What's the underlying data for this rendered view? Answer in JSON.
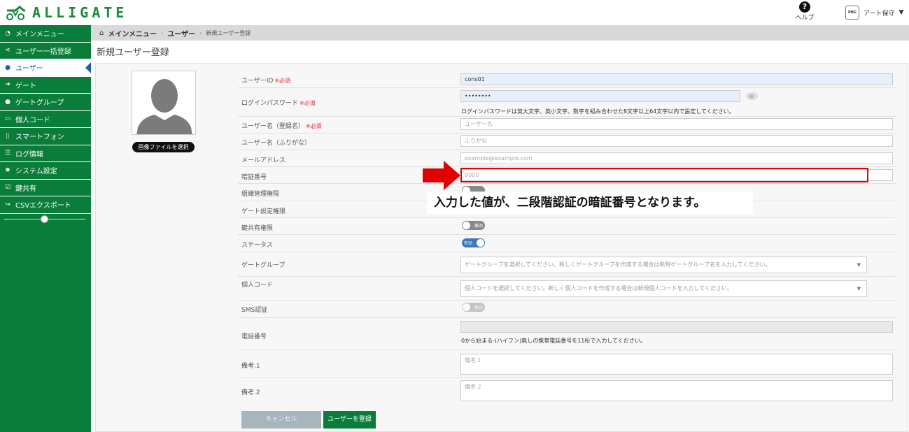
{
  "header": {
    "logo_text": "ALLIGATE",
    "help_label": "ヘルプ",
    "user_name": "アート保守",
    "user_icon_text": "PNG"
  },
  "sidebar": {
    "items": [
      {
        "label": "メインメニュー",
        "icon": "dashboard-icon"
      },
      {
        "label": "ユーザー一括登録",
        "icon": "share-icon"
      },
      {
        "label": "ユーザー",
        "icon": "user-icon"
      },
      {
        "label": "ゲート",
        "icon": "sign-in-icon"
      },
      {
        "label": "ゲートグループ",
        "icon": "group-icon"
      },
      {
        "label": "個人コード",
        "icon": "card-icon"
      },
      {
        "label": "スマートフォン",
        "icon": "mobile-icon"
      },
      {
        "label": "ログ情報",
        "icon": "list-icon"
      },
      {
        "label": "システム設定",
        "icon": "gear-icon"
      },
      {
        "label": "鍵共有",
        "icon": "check-square-icon"
      },
      {
        "label": "CSVエクスポート",
        "icon": "share-arrow-icon"
      }
    ]
  },
  "breadcrumb": {
    "home": "メインメニュー",
    "users": "ユーザー",
    "current": "新規ユーザー登録"
  },
  "page_title": "新規ユーザー登録",
  "avatar": {
    "select_button": "画像ファイルを選択"
  },
  "form": {
    "required_mark": "※必須",
    "user_id": {
      "label": "ユーザーID",
      "value": "cons01"
    },
    "password": {
      "label": "ログインパスワード",
      "value": "••••••••",
      "help": "ログインパスワードは英大文字、英小文字、数字を組み合わせた8文字以上64文字以内で設定してください。"
    },
    "user_name": {
      "label": "ユーザー名（登録名）",
      "placeholder": "ユーザー名"
    },
    "user_kana": {
      "label": "ユーザー名（ふりがな）",
      "placeholder": "ふりがな"
    },
    "email": {
      "label": "メールアドレス",
      "placeholder": "example@example.com"
    },
    "pin": {
      "label": "暗証番号",
      "placeholder": "0000"
    },
    "org_admin": {
      "label": "組織管理権限"
    },
    "gate_admin": {
      "label": "ゲート設定権限"
    },
    "key_share": {
      "label": "鍵共有権限",
      "toggle": "無効"
    },
    "status": {
      "label": "ステータス",
      "toggle": "有効"
    },
    "gate_group": {
      "label": "ゲートグループ",
      "placeholder": "ゲートグループを選択してください。新しくゲートグループを作成する場合は新規ゲートグループ名を入力してください。"
    },
    "personal_code": {
      "label": "個人コード",
      "placeholder": "個人コードを選択してください。新しく個人コードを作成する場合は新規個人コードを入力してください。"
    },
    "sms": {
      "label": "SMS認証",
      "toggle": "無効"
    },
    "phone": {
      "label": "電話番号",
      "help": "0から始まる-(ハイフン)無しの携帯電話番号を11桁で入力してください。"
    },
    "note1": {
      "label": "備考.1",
      "placeholder": "備考.1"
    },
    "note2": {
      "label": "備考.2",
      "placeholder": "備考.2"
    },
    "cancel": "キャンセル",
    "submit": "ユーザーを登録"
  },
  "annotation": {
    "callout": "入力した値が、二段階認証の暗証番号となります。",
    "highlight_color": "#e30000"
  },
  "colors": {
    "brand_green": "#0b7d3a",
    "active_blue": "#1a5fb0"
  }
}
